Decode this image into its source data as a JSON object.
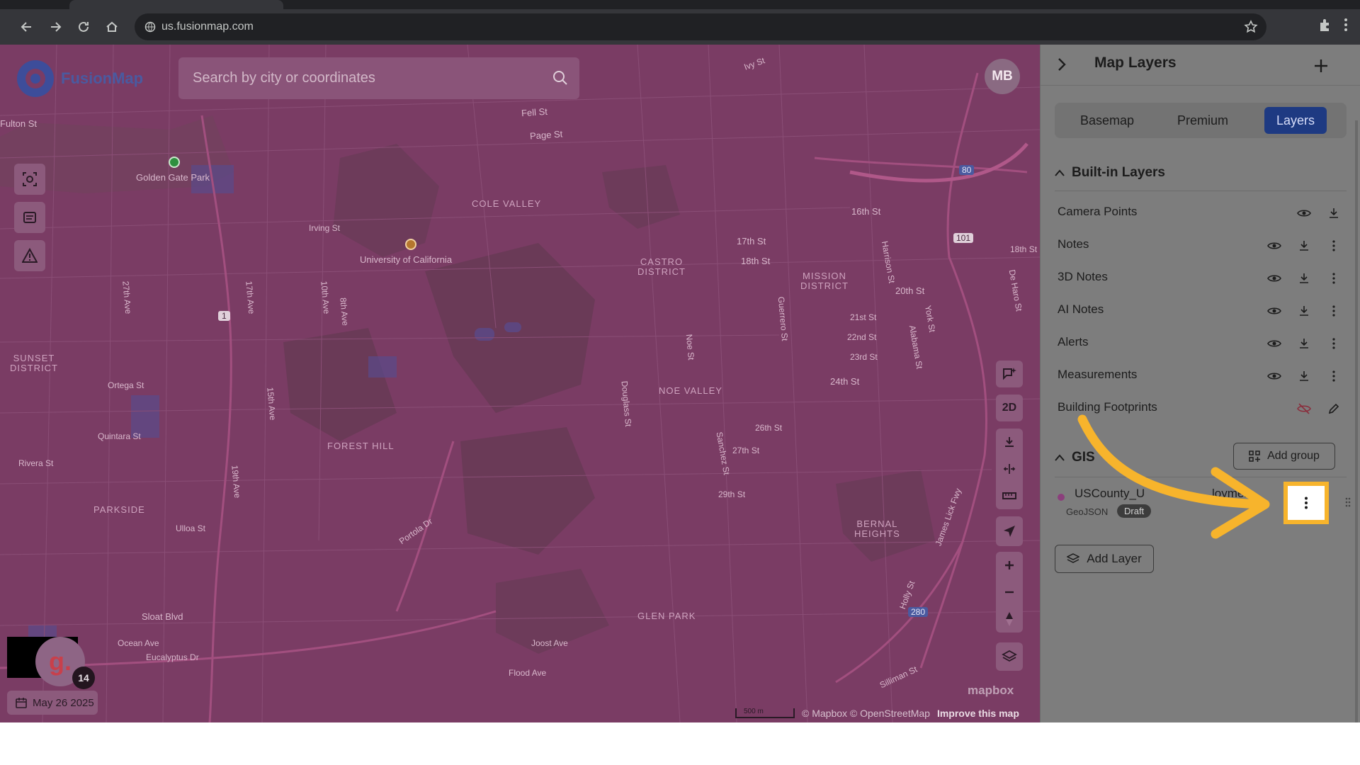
{
  "browser": {
    "url": "us.fusionmap.com"
  },
  "app": {
    "logo_text": "FusionMap",
    "search_placeholder": "Search by city or coordinates",
    "user_initials": "MB",
    "date": "May 26 2025",
    "notification_letter": "g.",
    "notification_count": "14",
    "view_mode": "2D"
  },
  "map": {
    "labels": {
      "ivy": "Ivy St",
      "fell": "Fell St",
      "page": "Page St",
      "fulton": "Fulton St",
      "ggpark": "Golden Gate Park",
      "colevalley": "COLE VALLEY",
      "irving": "Irving St",
      "ucal": "University of California",
      "castro": "CASTRO\nDISTRICT",
      "mission": "MISSION\nDISTRICT",
      "s16": "16th St",
      "s17": "17th St",
      "s18": "18th St",
      "s20": "20th St",
      "s21": "21st St",
      "s22": "22nd St",
      "s23": "23rd St",
      "s24": "24th St",
      "s26": "26th St",
      "s27": "27th St",
      "s29": "29th St",
      "harrison": "Harrison St",
      "sunset": "SUNSET\nDISTRICT",
      "ortega": "Ortega St",
      "quintara": "Quintara St",
      "rivera": "Rivera St",
      "parkside": "PARKSIDE",
      "ulloa": "Ulloa St",
      "foresthill": "FOREST HILL",
      "noevalley": "NOE VALLEY",
      "bernal": "BERNAL\nHEIGHTS",
      "glenpark": "GLEN PARK",
      "sloat": "Sloat Blvd",
      "ocean": "Ocean Ave",
      "eucalyptus": "Eucalyptus Dr",
      "joost": "Joost Ave",
      "flood": "Flood Ave",
      "portola": "Portola Dr",
      "douglass": "Douglass St",
      "guerrero": "Guerrero St",
      "noe": "Noe St",
      "sanchez": "Sanchez St",
      "alabama": "Alabama St",
      "york": "York St",
      "deharo": "De Haro St",
      "jameslick": "James Lick Fwy",
      "silliman": "Silliman St",
      "holly": "Holly St",
      "ave19": "19th Ave",
      "ave15": "15th Ave",
      "ave10": "10th Ave",
      "ave8": "8th Ave",
      "ave17": "17th Ave",
      "ave27": "27th Ave",
      "hwy1": "1",
      "hwy101": "101",
      "hwy80": "80",
      "hwy280": "280"
    },
    "mapbox_logo": "mapbox",
    "scale": "500 m",
    "attribution": "© Mapbox © OpenStreetMap",
    "improve": "Improve this map"
  },
  "panel": {
    "title": "Map Layers",
    "tabs": [
      "Basemap",
      "Premium",
      "Layers"
    ],
    "active_tab": "Layers",
    "builtin_title": "Built-in Layers",
    "builtin_layers": [
      {
        "name": "Camera Points"
      },
      {
        "name": "Notes"
      },
      {
        "name": "3D Notes"
      },
      {
        "name": "AI Notes"
      },
      {
        "name": "Alerts"
      },
      {
        "name": "Measurements"
      },
      {
        "name": "Building Footprints"
      }
    ],
    "gis_title": "GIS",
    "add_group": "Add group",
    "gis_layer": {
      "name": "USCounty_U",
      "name_tail": "loymen",
      "format": "GeoJSON",
      "status": "Draft",
      "color": "#8b3f7c"
    },
    "add_layer": "Add Layer"
  },
  "highlight_color": "#f7b42c"
}
